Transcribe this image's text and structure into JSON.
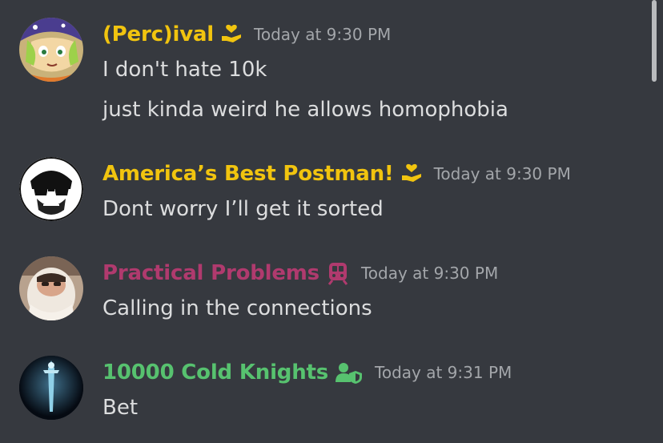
{
  "colors": {
    "background": "#36393f",
    "text": "#dcddde",
    "timestamp": "#a3a6aa",
    "gold": "#f1c40f",
    "pink": "#b03a6e",
    "green": "#57c26f"
  },
  "messages": [
    {
      "username": "(Perc)ival",
      "role_icon": "hand-heart-icon",
      "timestamp": "Today at 9:30 PM",
      "lines": [
        "I don't hate 10k",
        "just kinda weird he allows homophobia"
      ]
    },
    {
      "username": "America’s Best Postman!",
      "role_icon": "hand-heart-icon",
      "timestamp": "Today at 9:30 PM",
      "lines": [
        "Dont worry I’ll get it sorted"
      ]
    },
    {
      "username": "Practical Problems",
      "role_icon": "train-icon",
      "timestamp": "Today at 9:30 PM",
      "lines": [
        "Calling in the connections"
      ]
    },
    {
      "username": "10000 Cold Knights",
      "role_icon": "user-shield-icon",
      "timestamp": "Today at 9:31 PM",
      "lines": [
        "Bet"
      ]
    }
  ]
}
